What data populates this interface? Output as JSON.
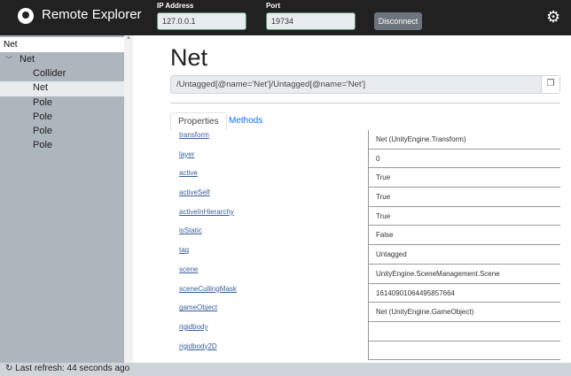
{
  "header": {
    "title": "Remote Explorer",
    "ip_label": "IP Address",
    "ip_value": "127.0.0.1",
    "port_label": "Port",
    "port_value": "19734",
    "disconnect_label": "Disconnect"
  },
  "sidebar": {
    "search_value": "Net",
    "items": [
      {
        "label": "Net"
      },
      {
        "label": "Collider"
      },
      {
        "label": "Net"
      },
      {
        "label": "Pole"
      },
      {
        "label": "Pole"
      },
      {
        "label": "Pole"
      },
      {
        "label": "Pole"
      }
    ]
  },
  "main": {
    "title": "Net",
    "path": "/Untagged[@name='Net']/Untagged[@name='Net']",
    "tabs": [
      "Properties",
      "Methods"
    ],
    "properties": [
      {
        "name": "transform",
        "value": "Net (UnityEngine.Transform)"
      },
      {
        "name": "layer",
        "value": "0"
      },
      {
        "name": "active",
        "value": "True"
      },
      {
        "name": "activeSelf",
        "value": "True"
      },
      {
        "name": "activeInHierarchy",
        "value": "True"
      },
      {
        "name": "isStatic",
        "value": "False"
      },
      {
        "name": "tag",
        "value": "Untagged"
      },
      {
        "name": "scene",
        "value": "UnityEngine.SceneManagement.Scene"
      },
      {
        "name": "sceneCullingMask",
        "value": "16140901064495857664"
      },
      {
        "name": "gameObject",
        "value": "Net (UnityEngine.GameObject)"
      },
      {
        "name": "rigidbody",
        "value": ""
      },
      {
        "name": "rigidbody2D",
        "value": ""
      }
    ]
  },
  "footer": {
    "status": "Last refresh: 44 seconds ago"
  }
}
